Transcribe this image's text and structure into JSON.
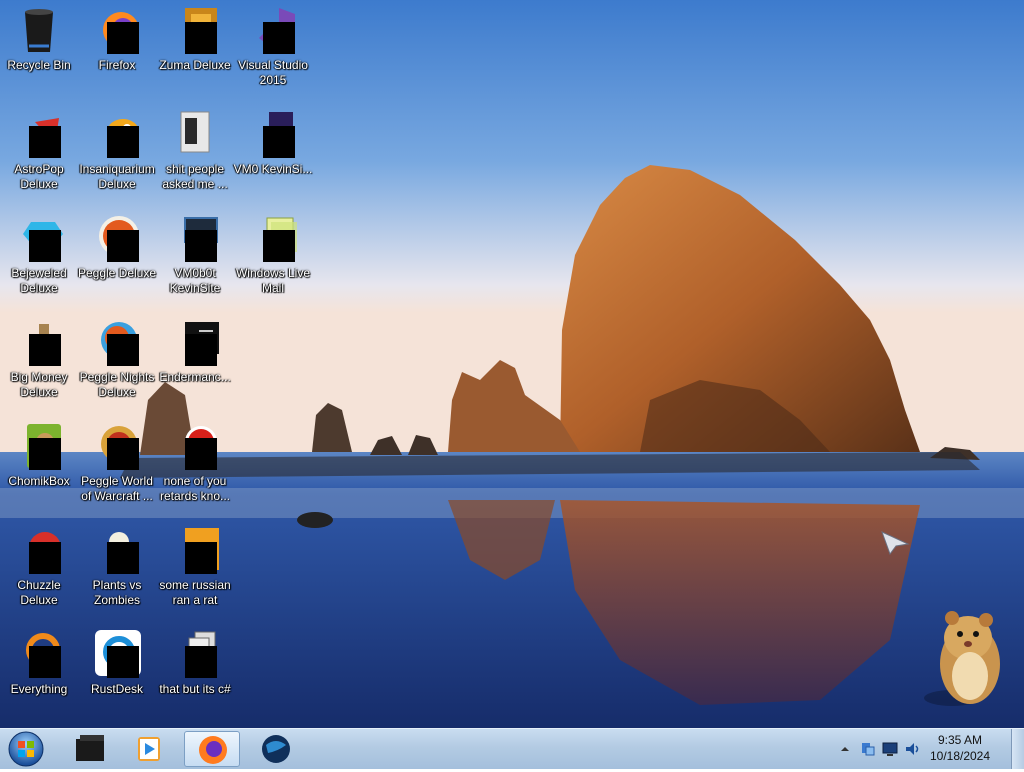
{
  "desktop": {
    "icons": [
      {
        "label": "Recycle Bin",
        "icon": "recycle-bin-icon"
      },
      {
        "label": "Firefox",
        "icon": "firefox-icon"
      },
      {
        "label": "Zuma Deluxe",
        "icon": "zuma-icon"
      },
      {
        "label": "Visual Studio 2015",
        "icon": "visual-studio-icon"
      },
      {
        "label": "AstroPop Deluxe",
        "icon": "astropop-icon"
      },
      {
        "label": "Insaniquarium Deluxe",
        "icon": "insaniquarium-icon"
      },
      {
        "label": "shit people asked me ...",
        "icon": "folder-icon"
      },
      {
        "label": "VM0 KevinSi...",
        "icon": "vm-icon"
      },
      {
        "label": "Bejeweled Deluxe",
        "icon": "bejeweled-icon"
      },
      {
        "label": "Peggle Deluxe",
        "icon": "peggle-icon"
      },
      {
        "label": "VM0b0t KevinSite",
        "icon": "monitor-icon"
      },
      {
        "label": "Windows Live Mail",
        "icon": "mail-icon"
      },
      {
        "label": "Big Money Deluxe",
        "icon": "money-bag-icon"
      },
      {
        "label": "Peggle Nights Deluxe",
        "icon": "peggle-nights-icon"
      },
      {
        "label": "Endermanc...",
        "icon": "terminal-icon"
      },
      {
        "label": "ChomikBox",
        "icon": "chomikbox-icon"
      },
      {
        "label": "Peggle World of Warcraft ...",
        "icon": "peggle-wow-icon"
      },
      {
        "label": "none of you retards kno...",
        "icon": "record-icon"
      },
      {
        "label": "Chuzzle Deluxe",
        "icon": "chuzzle-icon"
      },
      {
        "label": "Plants vs Zombies",
        "icon": "plants-icon"
      },
      {
        "label": "some russian ran a rat",
        "icon": "java-file-icon"
      },
      {
        "label": "Everything",
        "icon": "everything-search-icon"
      },
      {
        "label": "RustDesk",
        "icon": "rustdesk-icon"
      },
      {
        "label": "that but its c#",
        "icon": "copy-stack-icon"
      }
    ]
  },
  "taskbar": {
    "start_icon": "windows-orb-icon",
    "pinned": [
      {
        "icon": "desktop-app-icon"
      },
      {
        "icon": "media-player-icon"
      },
      {
        "icon": "firefox-icon",
        "active": true
      },
      {
        "icon": "globe-icon"
      }
    ],
    "tray": {
      "icons": [
        "chevron-up-icon",
        "network-icon",
        "monitor-icon",
        "volume-icon"
      ],
      "time": "9:35 AM",
      "date": "10/18/2024"
    }
  },
  "colors": {
    "sky_top": "#3f7fd0",
    "sky_bottom": "#f2e6de",
    "rock": "#b5652a",
    "water": "#1f3f86",
    "taskbar": "#b3cbe3"
  }
}
